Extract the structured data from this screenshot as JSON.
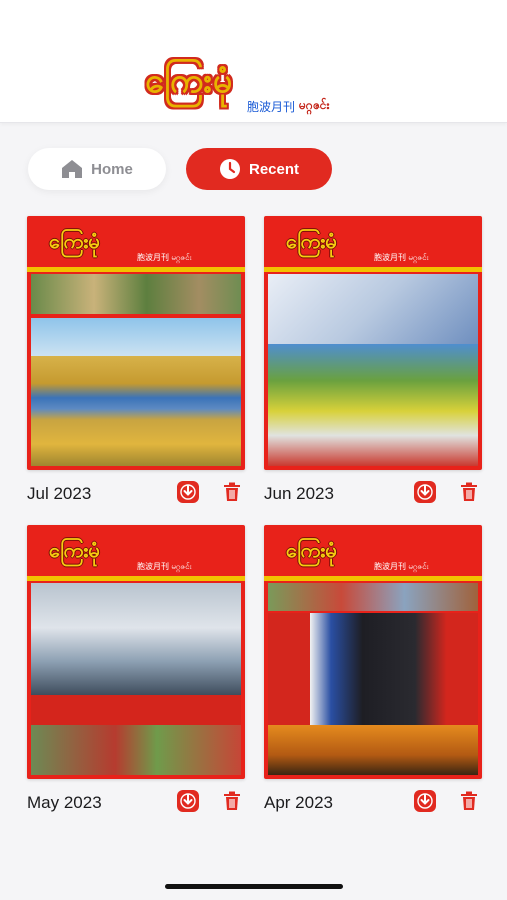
{
  "app": {
    "logo_text": "ကြေးမုံ",
    "logo_cn": "胞波月刊",
    "logo_my": "မဂ္ဂဇင်း"
  },
  "tabs": [
    {
      "label": "Home",
      "icon": "home-icon",
      "active": false
    },
    {
      "label": "Recent",
      "icon": "clock-icon",
      "active": true
    }
  ],
  "magazines": [
    {
      "label": "Jul 2023",
      "cover_title": "ကြေးမုံ",
      "cover_sub": "胞波月刊 မဂ္ဂဇင်း"
    },
    {
      "label": "Jun 2023",
      "cover_title": "ကြေးမုံ",
      "cover_sub": "胞波月刊 မဂ္ဂဇင်း"
    },
    {
      "label": "May 2023",
      "cover_title": "ကြေးမုံ",
      "cover_sub": "胞波月刊 မဂ္ဂဇင်း"
    },
    {
      "label": "Apr 2023",
      "cover_title": "ကြေးမုံ",
      "cover_sub": "胞波月刊 မဂ္ဂဇင်း"
    }
  ],
  "colors": {
    "accent": "#e12a20",
    "cover_red": "#e8221a",
    "logo_gold": "#e8b300"
  }
}
